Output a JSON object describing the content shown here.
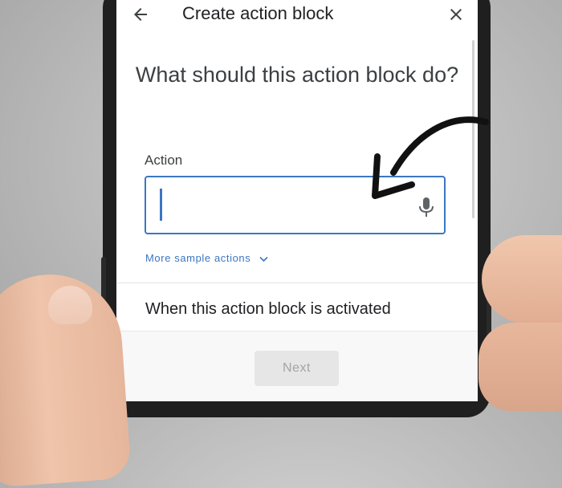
{
  "app_bar": {
    "title": "Create action block",
    "back_icon": "arrow-back-icon",
    "close_icon": "close-icon"
  },
  "main": {
    "question": "What should this action block do?",
    "action_field": {
      "label": "Action",
      "value": "",
      "mic_icon": "microphone-icon"
    },
    "sample_link": {
      "label": "More sample actions",
      "icon": "chevron-down-icon"
    },
    "activation_section_label": "When this action block is activated"
  },
  "footer": {
    "next_label": "Next"
  },
  "colors": {
    "accent": "#3b76c4",
    "text_primary": "#202124",
    "disabled_button_bg": "#e6e6e6",
    "disabled_button_text": "#a4a4a4"
  }
}
